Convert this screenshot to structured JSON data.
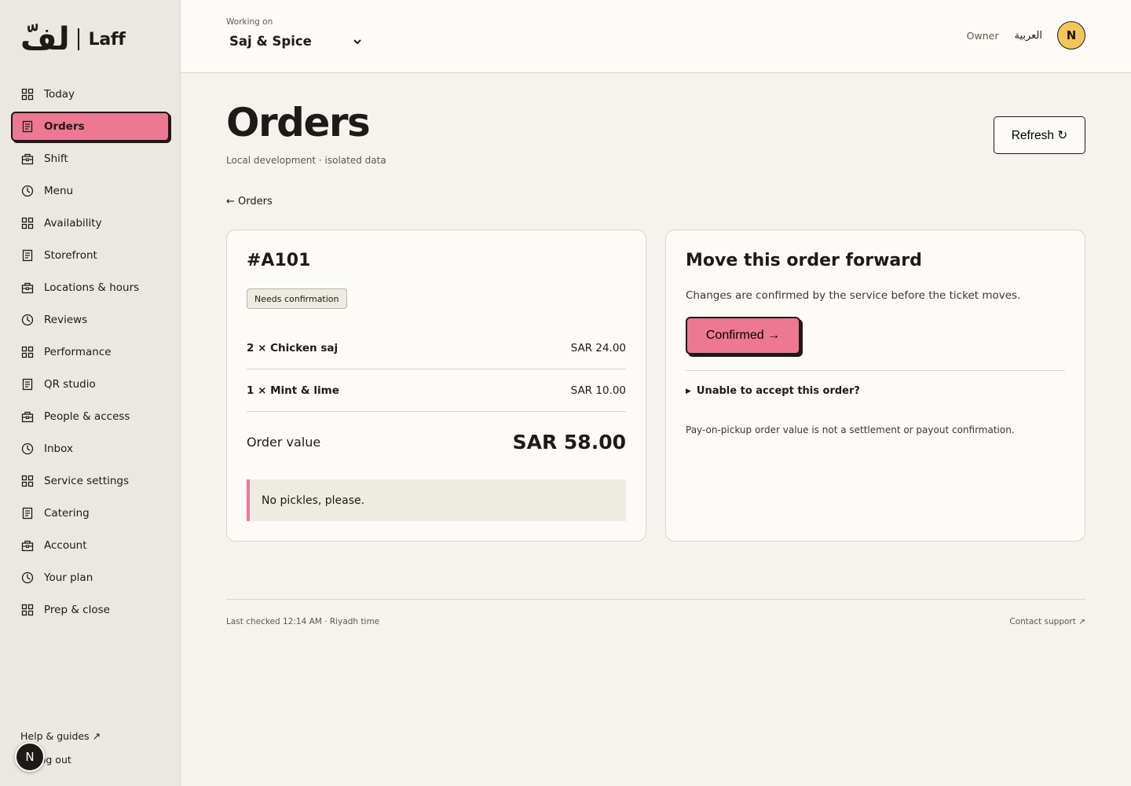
{
  "brand": {
    "arabic": "لفّ",
    "name": "Laff"
  },
  "sidebar": {
    "items": [
      {
        "label": "Today",
        "icon": "grid-icon"
      },
      {
        "label": "Orders",
        "icon": "document-icon",
        "active": true
      },
      {
        "label": "Shift",
        "icon": "bag-icon"
      },
      {
        "label": "Menu",
        "icon": "clock-icon"
      },
      {
        "label": "Availability",
        "icon": "grid-icon"
      },
      {
        "label": "Storefront",
        "icon": "document-icon"
      },
      {
        "label": "Locations & hours",
        "icon": "bag-icon"
      },
      {
        "label": "Reviews",
        "icon": "clock-icon"
      },
      {
        "label": "Performance",
        "icon": "grid-icon"
      },
      {
        "label": "QR studio",
        "icon": "document-icon"
      },
      {
        "label": "People & access",
        "icon": "bag-icon"
      },
      {
        "label": "Inbox",
        "icon": "clock-icon"
      },
      {
        "label": "Service settings",
        "icon": "grid-icon"
      },
      {
        "label": "Catering",
        "icon": "document-icon"
      },
      {
        "label": "Account",
        "icon": "bag-icon"
      },
      {
        "label": "Your plan",
        "icon": "clock-icon"
      },
      {
        "label": "Prep & close",
        "icon": "grid-icon"
      }
    ],
    "help_label": "Help & guides ↗",
    "logout_label": "Log out",
    "floating_avatar": "N"
  },
  "topbar": {
    "working_label": "Working on",
    "store_name": "Saj & Spice",
    "role": "Owner",
    "language": "العربية",
    "user_initial": "N"
  },
  "page": {
    "title": "Orders",
    "subtitle": "Local development · isolated data",
    "refresh_label": "Refresh ↻",
    "back_label": "← Orders"
  },
  "order": {
    "id": "#A101",
    "status": "Needs confirmation",
    "items": [
      {
        "name": "2 × Chicken saj",
        "price": "SAR 24.00"
      },
      {
        "name": "1 × Mint & lime",
        "price": "SAR 10.00"
      }
    ],
    "total_label": "Order value",
    "total_value": "SAR 58.00",
    "note": "No pickles, please."
  },
  "action_panel": {
    "title": "Move this order forward",
    "description": "Changes are confirmed by the service before the ticket moves.",
    "confirm_label": "Confirmed →",
    "reject_label": "Unable to accept this order?",
    "payment_note": "Pay-on-pickup order value is not a settlement or payout confirmation."
  },
  "footer": {
    "last_checked": "Last checked 12:14 AM · Riyadh time",
    "support_label": "Contact support ↗"
  },
  "colors": {
    "accent": "#ee7892",
    "avatar": "#f3c65a",
    "background": "#f5f3ee",
    "sidebar": "#ebe8e1"
  }
}
